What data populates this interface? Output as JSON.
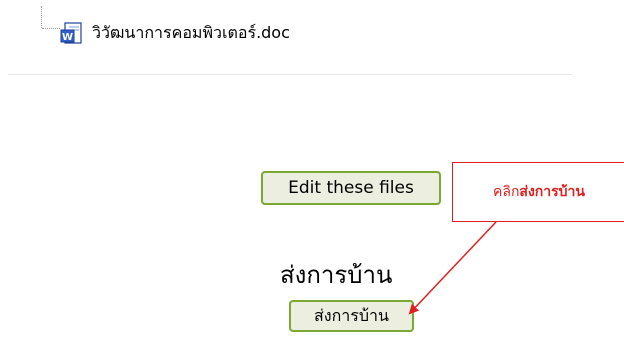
{
  "file": {
    "name": "วิวัฒนาการคอมพิวเตอร์.doc",
    "icon": "word-doc-icon"
  },
  "buttons": {
    "edit_files_label": "Edit these files",
    "submit_label": "ส่งการบ้าน"
  },
  "section": {
    "heading": "ส่งการบ้าน"
  },
  "annotation": {
    "prefix": "คลิก",
    "emphasis": "ส่งการบ้าน",
    "color": "#e02020"
  },
  "colors": {
    "button_border": "#7aaa34",
    "button_bg": "#ecefe0"
  }
}
